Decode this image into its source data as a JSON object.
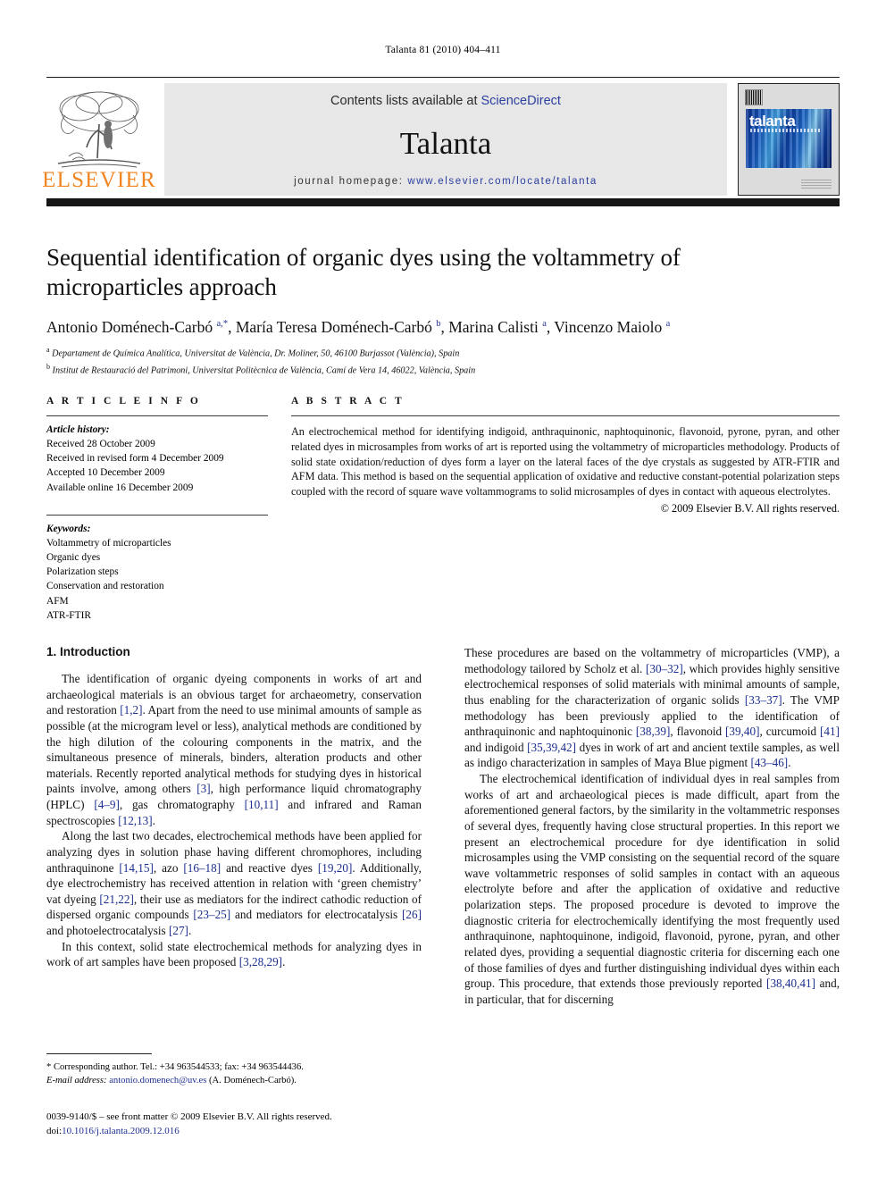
{
  "running_head": "Talanta 81 (2010) 404–411",
  "masthead": {
    "contents_prefix": "Contents lists available at ",
    "sciencedirect": "ScienceDirect",
    "journal_title": "Talanta",
    "homepage_prefix": "journal homepage:",
    "homepage_url": "www.elsevier.com/locate/talanta",
    "publisher_wordmark": "ELSEVIER",
    "cover_wordmark": "talanta",
    "accent_orange": "#F08521",
    "link_blue": "#2b3fa0"
  },
  "article": {
    "title": "Sequential identification of organic dyes using the voltammetry of microparticles approach",
    "authors_html": "Antonio Doménech-Carbó <sup>a,</sup><sup>*</sup>, María Teresa Doménech-Carbó <sup>b</sup>, Marina Calisti <sup>a</sup>, Vincenzo Maiolo <sup>a</sup>",
    "affiliation_a": "Departament de Química Analítica, Universitat de València, Dr. Moliner, 50, 46100 Burjassot (València), Spain",
    "affiliation_b": "Institut de Restauració del Patrimoni, Universitat Politècnica de València, Camí de Vera 14, 46022, València, Spain"
  },
  "article_info": {
    "heading": "A R T I C L E    I N F O",
    "history_label": "Article history:",
    "history": [
      "Received 28 October 2009",
      "Received in revised form 4 December 2009",
      "Accepted 10 December 2009",
      "Available online 16 December 2009"
    ],
    "keywords_label": "Keywords:",
    "keywords": [
      "Voltammetry of microparticles",
      "Organic dyes",
      "Polarization steps",
      "Conservation and restoration",
      "AFM",
      "ATR-FTIR"
    ]
  },
  "abstract": {
    "heading": "A B S T R A C T",
    "text": "An electrochemical method for identifying indigoid, anthraquinonic, naphtoquinonic, flavonoid, pyrone, pyran, and other related dyes in microsamples from works of art is reported using the voltammetry of microparticles methodology. Products of solid state oxidation/reduction of dyes form a layer on the lateral faces of the dye crystals as suggested by ATR-FTIR and AFM data. This method is based on the sequential application of oxidative and reductive constant-potential polarization steps coupled with the record of square wave voltammograms to solid microsamples of dyes in contact with aqueous electrolytes.",
    "copyright": "© 2009 Elsevier B.V. All rights reserved."
  },
  "introduction": {
    "heading": "1. Introduction",
    "left_paragraphs": [
      "The identification of organic dyeing components in works of art and archaeological materials is an obvious target for archaeometry, conservation and restoration [1,2]. Apart from the need to use minimal amounts of sample as possible (at the microgram level or less), analytical methods are conditioned by the high dilution of the colouring components in the matrix, and the simultaneous presence of minerals, binders, alteration products and other materials. Recently reported analytical methods for studying dyes in historical paints involve, among others [3], high performance liquid chromatography (HPLC) [4–9], gas chromatography [10,11] and infrared and Raman spectroscopies [12,13].",
      "Along the last two decades, electrochemical methods have been applied for analyzing dyes in solution phase having different chromophores, including anthraquinone [14,15], azo [16–18] and reactive dyes [19,20]. Additionally, dye electrochemistry has received attention in relation with ‘green chemistry’ vat dyeing [21,22], their use as mediators for the indirect cathodic reduction of dispersed organic compounds [23–25] and mediators for electrocatalysis [26] and photoelectrocatalysis [27].",
      "In this context, solid state electrochemical methods for analyzing dyes in work of art samples have been proposed [3,28,29]."
    ],
    "right_paragraphs": [
      "These procedures are based on the voltammetry of microparticles (VMP), a methodology tailored by Scholz et al. [30–32], which provides highly sensitive electrochemical responses of solid materials with minimal amounts of sample, thus enabling for the characterization of organic solids [33–37]. The VMP methodology has been previously applied to the identification of anthraquinonic and naphtoquinonic [38,39], flavonoid [39,40], curcumoid [41] and indigoid [35,39,42] dyes in work of art and ancient textile samples, as well as indigo characterization in samples of Maya Blue pigment [43–46].",
      "The electrochemical identification of individual dyes in real samples from works of art and archaeological pieces is made difficult, apart from the aforementioned general factors, by the similarity in the voltammetric responses of several dyes, frequently having close structural properties. In this report we present an electrochemical procedure for dye identification in solid microsamples using the VMP consisting on the sequential record of the square wave voltammetric responses of solid samples in contact with an aqueous electrolyte before and after the application of oxidative and reductive polarization steps. The proposed procedure is devoted to improve the diagnostic criteria for electrochemically identifying the most frequently used anthraquinone, naphtoquinone, indigoid, flavonoid, pyrone, pyran, and other related dyes, providing a sequential diagnostic criteria for discerning each one of those families of dyes and further distinguishing individual dyes within each group. This procedure, that extends those previously reported [38,40,41] and, in particular, that for discerning"
    ]
  },
  "footnote": {
    "corresponding": "* Corresponding author. Tel.: +34 963544533; fax: +34 963544436.",
    "email_label": "E-mail address:",
    "email": "antonio.domenech@uv.es",
    "email_suffix": "(A. Doménech-Carbó)."
  },
  "imprint": {
    "line1": "0039-9140/$ – see front matter © 2009 Elsevier B.V. All rights reserved.",
    "doi_label": "doi:",
    "doi": "10.1016/j.talanta.2009.12.016"
  }
}
